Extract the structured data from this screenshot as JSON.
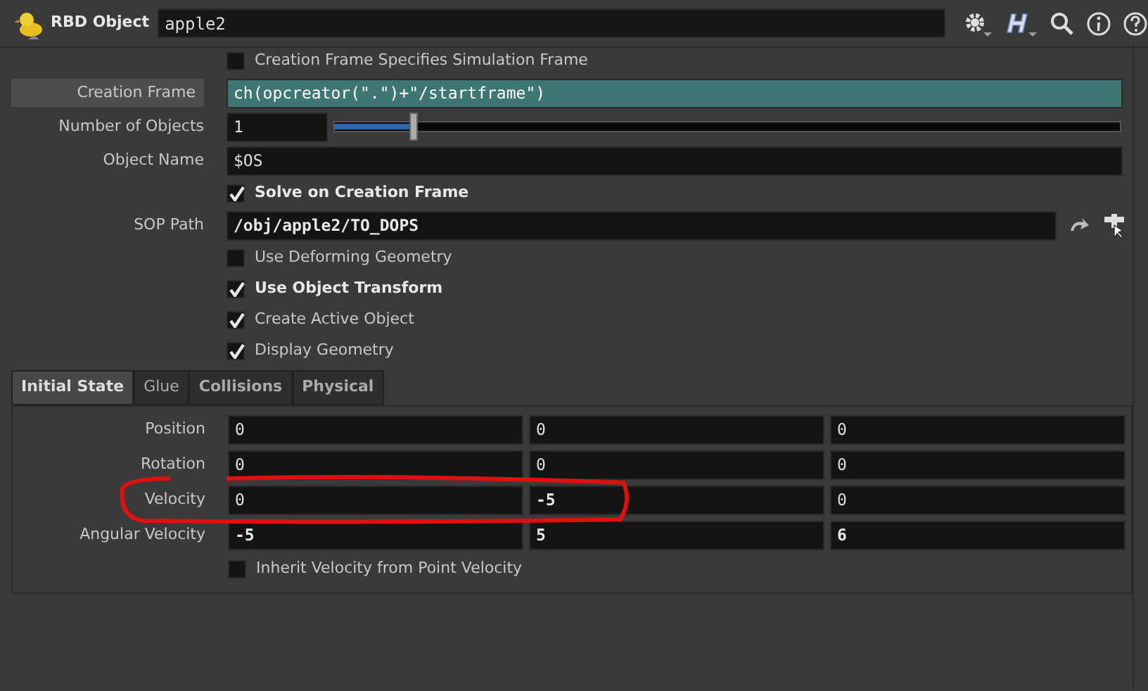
{
  "header": {
    "node_type": "RBD Object",
    "node_name": "apple2"
  },
  "params": [
    {
      "kind": "checkbox",
      "label": "Creation Frame Specifies Simulation Frame",
      "checked": false,
      "modified": false
    },
    {
      "kind": "text",
      "label": "Creation Frame",
      "value": "ch(opcreator(\".\")+\"/startframe\")",
      "expression": true,
      "modified": false
    },
    {
      "kind": "slider",
      "label": "Number of Objects",
      "value": "1",
      "level": 0.1,
      "modified": false
    },
    {
      "kind": "text",
      "label": "Object Name",
      "value": "$OS",
      "expression": false,
      "modified": false
    },
    {
      "kind": "checkbox",
      "label": "Solve on Creation Frame",
      "checked": true,
      "modified": true
    },
    {
      "kind": "path",
      "label": "SOP Path",
      "value": "/obj/apple2/TO_DOPS",
      "modified": true
    },
    {
      "kind": "checkbox",
      "label": "Use Deforming Geometry",
      "checked": false,
      "modified": false
    },
    {
      "kind": "checkbox",
      "label": "Use Object Transform",
      "checked": true,
      "modified": true
    },
    {
      "kind": "checkbox",
      "label": "Create Active Object",
      "checked": true,
      "modified": false
    },
    {
      "kind": "checkbox",
      "label": "Display Geometry",
      "checked": true,
      "modified": false
    }
  ],
  "tabs": [
    {
      "label": "Initial State",
      "selected": true,
      "modified": true
    },
    {
      "label": "Glue",
      "selected": false,
      "modified": false
    },
    {
      "label": "Collisions",
      "selected": false,
      "modified": true
    },
    {
      "label": "Physical",
      "selected": false,
      "modified": true
    }
  ],
  "vectors": [
    {
      "label": "Position",
      "values": [
        {
          "value": "0",
          "modified": false
        },
        {
          "value": "0",
          "modified": false
        },
        {
          "value": "0",
          "modified": false
        }
      ]
    },
    {
      "label": "Rotation",
      "values": [
        {
          "value": "0",
          "modified": false
        },
        {
          "value": "0",
          "modified": false
        },
        {
          "value": "0",
          "modified": false
        }
      ]
    },
    {
      "label": "Velocity",
      "values": [
        {
          "value": "0",
          "modified": false
        },
        {
          "value": "-5",
          "modified": true
        },
        {
          "value": "0",
          "modified": false
        }
      ]
    },
    {
      "label": "Angular Velocity",
      "values": [
        {
          "value": "-5",
          "modified": true
        },
        {
          "value": "5",
          "modified": true
        },
        {
          "value": "6",
          "modified": true
        }
      ]
    }
  ],
  "bottom_checkbox": {
    "label": "Inherit Velocity from Point Velocity",
    "checked": false,
    "modified": false
  }
}
